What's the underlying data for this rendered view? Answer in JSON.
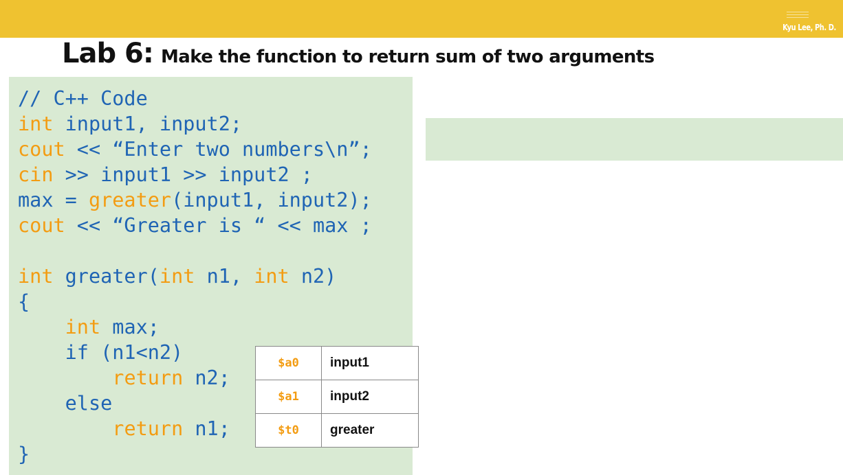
{
  "header": {
    "author": "Kyu Lee, Ph. D."
  },
  "title": {
    "lab": "Lab 6:",
    "text": "Make the function to return sum of two arguments"
  },
  "code": {
    "lines": [
      [
        {
          "t": "// C++ Code",
          "k": 0
        }
      ],
      [
        {
          "t": "int",
          "k": 1
        },
        {
          "t": " input1, input2;",
          "k": 0
        }
      ],
      [
        {
          "t": "cout",
          "k": 1
        },
        {
          "t": " << “Enter two numbers\\n”;",
          "k": 0
        }
      ],
      [
        {
          "t": "cin",
          "k": 1
        },
        {
          "t": " >> input1 >> input2 ;",
          "k": 0
        }
      ],
      [
        {
          "t": "max = ",
          "k": 0
        },
        {
          "t": "greater",
          "k": 1
        },
        {
          "t": "(input1, input2);",
          "k": 0
        }
      ],
      [
        {
          "t": "cout",
          "k": 1
        },
        {
          "t": " << “Greater is “ << max ;",
          "k": 0
        }
      ],
      [],
      [
        {
          "t": "int",
          "k": 1
        },
        {
          "t": " greater(",
          "k": 0
        },
        {
          "t": "int",
          "k": 1
        },
        {
          "t": " n1, ",
          "k": 0
        },
        {
          "t": "int",
          "k": 1
        },
        {
          "t": " n2)",
          "k": 0
        }
      ],
      [
        {
          "t": "{",
          "k": 0
        }
      ],
      [
        {
          "t": "    ",
          "k": 0
        },
        {
          "t": "int",
          "k": 1
        },
        {
          "t": " max;",
          "k": 0
        }
      ],
      [
        {
          "t": "    if (n1<n2)",
          "k": 0
        }
      ],
      [
        {
          "t": "        ",
          "k": 0
        },
        {
          "t": "return",
          "k": 1
        },
        {
          "t": " n2;",
          "k": 0
        }
      ],
      [
        {
          "t": "    else",
          "k": 0
        }
      ],
      [
        {
          "t": "        ",
          "k": 0
        },
        {
          "t": "return",
          "k": 1
        },
        {
          "t": " n1;",
          "k": 0
        }
      ],
      [
        {
          "t": "}",
          "k": 0
        }
      ]
    ]
  },
  "register_table": {
    "rows": [
      {
        "register": "$a0",
        "variable": "input1"
      },
      {
        "register": "$a1",
        "variable": "input2"
      },
      {
        "register": "$t0",
        "variable": "greater"
      }
    ]
  },
  "colors": {
    "header_bar": "#EFC230",
    "code_background": "#D9EAD3",
    "code_text": "#1F64B4",
    "keyword": "#F39C12"
  }
}
